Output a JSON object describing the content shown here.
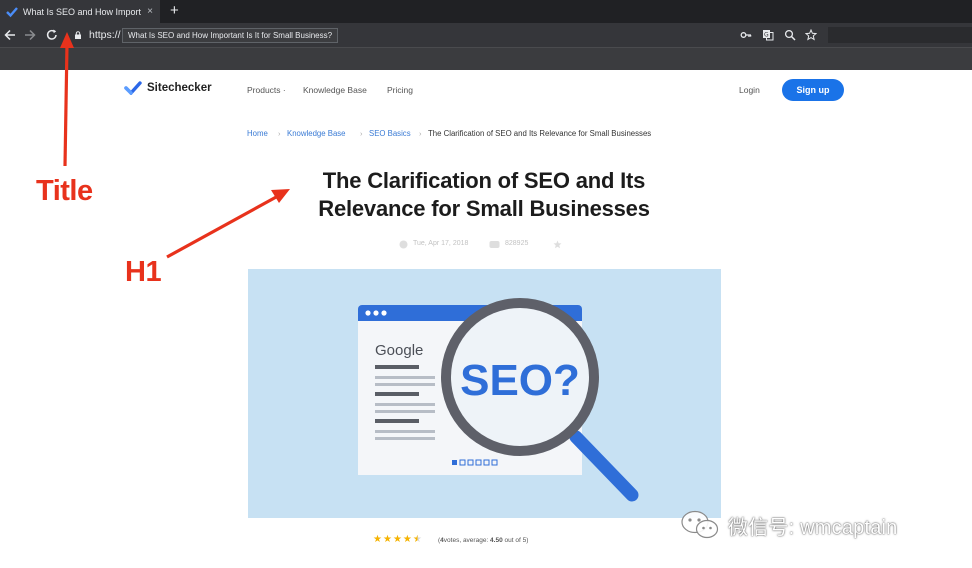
{
  "browser": {
    "tab_title": "What Is SEO and How Importan",
    "tab_close": "×",
    "new_tab": "+",
    "url_prefix": "https://",
    "url_tooltip": "What Is SEO and How Important Is It for Small Business?"
  },
  "site": {
    "logo_text": "Sitechecker",
    "nav": {
      "products": "Products ·",
      "knowledge_base": "Knowledge Base",
      "pricing": "Pricing",
      "login": "Login",
      "signup": "Sign up"
    }
  },
  "breadcrumb": {
    "home": "Home",
    "knowledge_base": "Knowledge Base",
    "seo_basics": "SEO Basics",
    "current": "The Clarification of SEO and Its Relevance for Small Businesses",
    "separator": "›"
  },
  "article": {
    "h1_line1": "The Clarification of SEO and Its",
    "h1_line2": "Relevance for Small Businesses",
    "date": "Tue, Apr 17, 2018",
    "views": "828925"
  },
  "hero": {
    "search_engine_label": "Google",
    "magnifier_text": "SEO?"
  },
  "rating": {
    "stars": 4.5,
    "votes": "4",
    "average": "4.50",
    "prefix": "(",
    "votes_suffix": "votes, average: ",
    "out_of": " out of 5)"
  },
  "annotations": {
    "title_label": "Title",
    "h1_label": "H1",
    "color": "#e8321c"
  },
  "watermark": {
    "text": "微信号: wmcaptain"
  },
  "colors": {
    "accent": "#1a73e8",
    "chrome_dark": "#202124",
    "hero_bg": "#c7e1f3"
  }
}
